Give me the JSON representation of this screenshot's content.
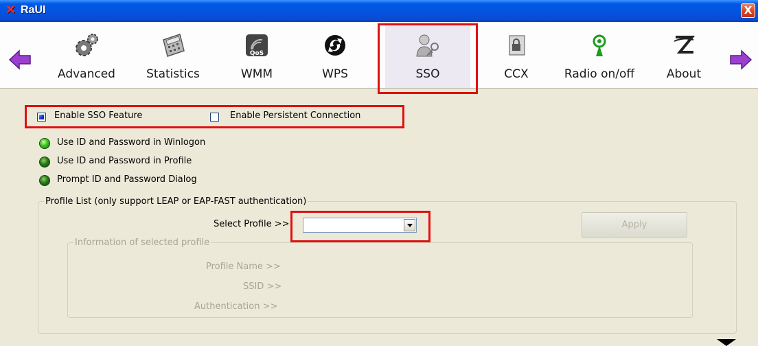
{
  "window": {
    "title": "RaUI",
    "close_label": "X"
  },
  "toolbar": {
    "items": [
      {
        "label": "Advanced",
        "icon": "gears-icon"
      },
      {
        "label": "Statistics",
        "icon": "calculator-icon"
      },
      {
        "label": "WMM",
        "icon": "qos-icon"
      },
      {
        "label": "WPS",
        "icon": "wps-icon"
      },
      {
        "label": "SSO",
        "icon": "user-key-icon"
      },
      {
        "label": "CCX",
        "icon": "lock-doc-icon"
      },
      {
        "label": "Radio on/off",
        "icon": "radio-tower-icon"
      },
      {
        "label": "About",
        "icon": "z-logo-icon"
      }
    ],
    "active": "SSO"
  },
  "sso": {
    "enable_sso": {
      "label": "Enable SSO Feature",
      "checked": true
    },
    "persistent": {
      "label": "Enable Persistent Connection",
      "checked": false
    },
    "options": [
      {
        "label": "Use ID and Password in Winlogon",
        "selected": true
      },
      {
        "label": "Use ID and Password in Profile",
        "selected": false
      },
      {
        "label": "Prompt ID and Password Dialog",
        "selected": false
      }
    ],
    "profile_list": {
      "legend": "Profile List (only support LEAP or EAP-FAST authentication)",
      "select_label": "Select Profile >>",
      "select_value": "",
      "apply_label": "Apply",
      "info": {
        "legend": "Information of selected profile",
        "profile_name": "Profile Name >>",
        "ssid": "SSID >>",
        "authentication": "Authentication >>"
      }
    }
  },
  "colors": {
    "highlight": "#e01010",
    "titlebar": "#0453dd",
    "background": "#ece9d8"
  }
}
